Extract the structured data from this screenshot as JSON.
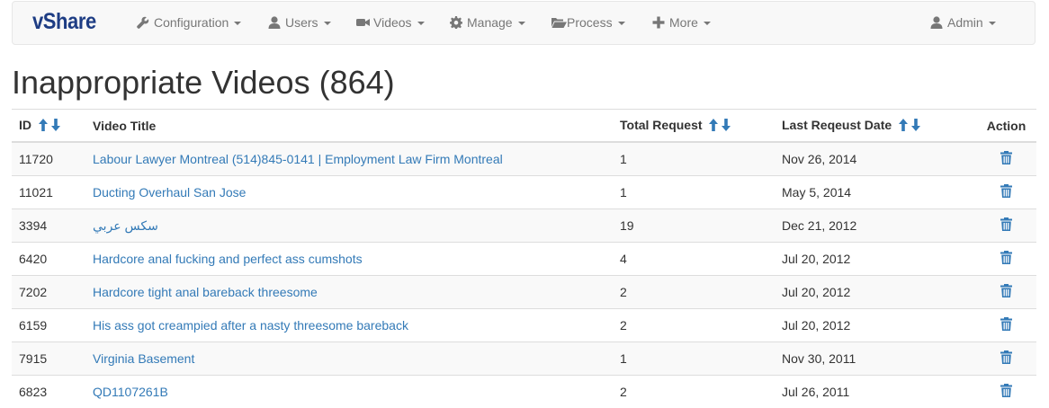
{
  "brand": "vShare",
  "nav": {
    "items": [
      {
        "label": "Configuration",
        "icon": "wrench-icon"
      },
      {
        "label": "Users",
        "icon": "user-icon"
      },
      {
        "label": "Videos",
        "icon": "video-camera-icon"
      },
      {
        "label": "Manage",
        "icon": "gear-icon"
      },
      {
        "label": "Process",
        "icon": "folder-open-icon"
      },
      {
        "label": "More",
        "icon": "plus-icon"
      }
    ],
    "user": {
      "label": "Admin",
      "icon": "user-icon"
    }
  },
  "page_title": "Inappropriate Videos (864)",
  "table": {
    "headers": {
      "id": "ID",
      "title": "Video Title",
      "total": "Total Request",
      "date": "Last Reqeust Date",
      "action": "Action"
    },
    "rows": [
      {
        "id": "11720",
        "title": "Labour Lawyer Montreal (514)845-0141 | Employment Law Firm Montreal",
        "total": "1",
        "date": "Nov 26, 2014"
      },
      {
        "id": "11021",
        "title": "Ducting Overhaul San Jose",
        "total": "1",
        "date": "May 5, 2014"
      },
      {
        "id": "3394",
        "title": "سكس عربي",
        "total": "19",
        "date": "Dec 21, 2012"
      },
      {
        "id": "6420",
        "title": "Hardcore anal fucking and perfect ass cumshots",
        "total": "4",
        "date": "Jul 20, 2012"
      },
      {
        "id": "7202",
        "title": "Hardcore tight anal bareback threesome",
        "total": "2",
        "date": "Jul 20, 2012"
      },
      {
        "id": "6159",
        "title": "His ass got creampied after a nasty threesome bareback",
        "total": "2",
        "date": "Jul 20, 2012"
      },
      {
        "id": "7915",
        "title": "Virginia Basement",
        "total": "1",
        "date": "Nov 30, 2011"
      },
      {
        "id": "6823",
        "title": "QD1107261B",
        "total": "2",
        "date": "Jul 26, 2011"
      }
    ]
  },
  "colors": {
    "link": "#337ab7",
    "brand": "#1e3d84",
    "nav_text": "#777777"
  }
}
